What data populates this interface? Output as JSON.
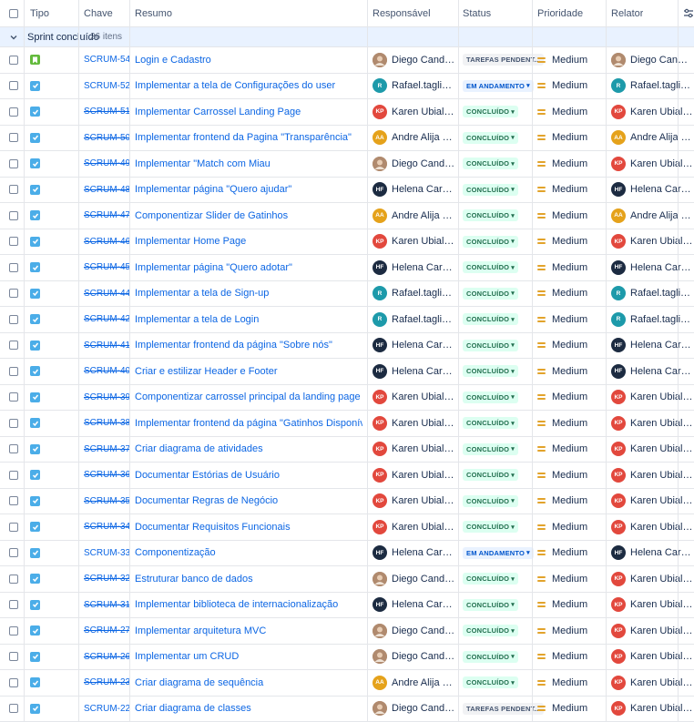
{
  "headers": {
    "type": "Tipo",
    "key": "Chave",
    "summary": "Resumo",
    "assignee": "Responsável",
    "status": "Status",
    "priority": "Prioridade",
    "reporter": "Relator"
  },
  "group": {
    "label": "Sprint concluído",
    "count": "26 itens"
  },
  "colors": {
    "story": "#63ba3c",
    "task": "#4bade8",
    "priority": "#e2a32b",
    "link": "#0c66e4"
  },
  "people": {
    "DC": {
      "initials": "",
      "color": "#c9a98a",
      "photo": true
    },
    "RT": {
      "initials": "R",
      "color": "#1d9aaa"
    },
    "KP": {
      "initials": "KP",
      "color": "#e2483d"
    },
    "AA": {
      "initials": "AA",
      "color": "#e5a21b"
    },
    "HF": {
      "initials": "HF",
      "color": "#1c2b41"
    }
  },
  "rows": [
    {
      "type": "story",
      "key": "SCRUM-54",
      "done": false,
      "summary": "Login e Cadastro",
      "assignee": "Diego Candido",
      "assignee_id": "DC",
      "status": "TAREFAS PENDENT...",
      "status_kind": "todo",
      "priority": "Medium",
      "reporter": "Diego Candido",
      "reporter_id": "DC"
    },
    {
      "type": "task",
      "key": "SCRUM-52",
      "done": false,
      "summary": "Implementar a tela de Configurações do user",
      "assignee": "Rafael.tagliaferro",
      "assignee_id": "RT",
      "status": "EM ANDAMENTO",
      "status_kind": "prog",
      "priority": "Medium",
      "reporter": "Rafael.tagliaferro",
      "reporter_id": "RT"
    },
    {
      "type": "task",
      "key": "SCRUM-51",
      "done": true,
      "summary": "Implementar Carrossel Landing Page",
      "assignee": "Karen Ubial Pereira",
      "assignee_id": "KP",
      "status": "CONCLUÍDO",
      "status_kind": "done",
      "priority": "Medium",
      "reporter": "Karen Ubial Pereira",
      "reporter_id": "KP"
    },
    {
      "type": "task",
      "key": "SCRUM-50",
      "done": true,
      "summary": "Implementar frontend da Pagina \"Transparência\"",
      "assignee": "Andre Alija Ramo...",
      "assignee_id": "AA",
      "status": "CONCLUÍDO",
      "status_kind": "done",
      "priority": "Medium",
      "reporter": "Andre Alija Ramo...",
      "reporter_id": "AA"
    },
    {
      "type": "task",
      "key": "SCRUM-49",
      "done": true,
      "summary": "Implementar \"Match com Miau",
      "assignee": "Diego Candido",
      "assignee_id": "DC",
      "status": "CONCLUÍDO",
      "status_kind": "done",
      "priority": "Medium",
      "reporter": "Karen Ubial Pereira",
      "reporter_id": "KP"
    },
    {
      "type": "task",
      "key": "SCRUM-48",
      "done": true,
      "summary": "Implementar página \"Quero ajudar\"",
      "assignee": "Helena Carvalho ...",
      "assignee_id": "HF",
      "status": "CONCLUÍDO",
      "status_kind": "done",
      "priority": "Medium",
      "reporter": "Helena Carvalho ...",
      "reporter_id": "HF"
    },
    {
      "type": "task",
      "key": "SCRUM-47",
      "done": true,
      "summary": "Componentizar Slider de Gatinhos",
      "assignee": "Andre Alija Ramo...",
      "assignee_id": "AA",
      "status": "CONCLUÍDO",
      "status_kind": "done",
      "priority": "Medium",
      "reporter": "Andre Alija Ramo...",
      "reporter_id": "AA"
    },
    {
      "type": "task",
      "key": "SCRUM-46",
      "done": true,
      "summary": "Implementar Home Page",
      "assignee": "Karen Ubial Pereira",
      "assignee_id": "KP",
      "status": "CONCLUÍDO",
      "status_kind": "done",
      "priority": "Medium",
      "reporter": "Karen Ubial Pereira",
      "reporter_id": "KP"
    },
    {
      "type": "task",
      "key": "SCRUM-45",
      "done": true,
      "summary": "Implementar página \"Quero adotar\"",
      "assignee": "Helena Carvalho ...",
      "assignee_id": "HF",
      "status": "CONCLUÍDO",
      "status_kind": "done",
      "priority": "Medium",
      "reporter": "Helena Carvalho ...",
      "reporter_id": "HF"
    },
    {
      "type": "task",
      "key": "SCRUM-44",
      "done": true,
      "summary": "Implementar a tela de Sign-up",
      "assignee": "Rafael.tagliaferro",
      "assignee_id": "RT",
      "status": "CONCLUÍDO",
      "status_kind": "done",
      "priority": "Medium",
      "reporter": "Rafael.tagliaferro",
      "reporter_id": "RT"
    },
    {
      "type": "task",
      "key": "SCRUM-42",
      "done": true,
      "summary": "Implementar a tela de Login",
      "assignee": "Rafael.tagliaferro",
      "assignee_id": "RT",
      "status": "CONCLUÍDO",
      "status_kind": "done",
      "priority": "Medium",
      "reporter": "Rafael.tagliaferro",
      "reporter_id": "RT"
    },
    {
      "type": "task",
      "key": "SCRUM-41",
      "done": true,
      "summary": "Implementar frontend da página \"Sobre nós\"",
      "assignee": "Helena Carvalho ...",
      "assignee_id": "HF",
      "status": "CONCLUÍDO",
      "status_kind": "done",
      "priority": "Medium",
      "reporter": "Helena Carvalho ...",
      "reporter_id": "HF"
    },
    {
      "type": "task",
      "key": "SCRUM-40",
      "done": true,
      "summary": "Criar e estilizar Header e Footer",
      "assignee": "Helena Carvalho ...",
      "assignee_id": "HF",
      "status": "CONCLUÍDO",
      "status_kind": "done",
      "priority": "Medium",
      "reporter": "Helena Carvalho ...",
      "reporter_id": "HF"
    },
    {
      "type": "task",
      "key": "SCRUM-39",
      "done": true,
      "summary": "Componentizar carrossel principal da landing page",
      "assignee": "Karen Ubial Pereira",
      "assignee_id": "KP",
      "status": "CONCLUÍDO",
      "status_kind": "done",
      "priority": "Medium",
      "reporter": "Karen Ubial Pereira",
      "reporter_id": "KP"
    },
    {
      "type": "task",
      "key": "SCRUM-38",
      "done": true,
      "summary": "Implementar frontend da página \"Gatinhos Disponíveis\"",
      "assignee": "Karen Ubial Pereira",
      "assignee_id": "KP",
      "status": "CONCLUÍDO",
      "status_kind": "done",
      "priority": "Medium",
      "reporter": "Karen Ubial Pereira",
      "reporter_id": "KP"
    },
    {
      "type": "task",
      "key": "SCRUM-37",
      "done": true,
      "summary": "Criar diagrama de atividades",
      "assignee": "Karen Ubial Pereira",
      "assignee_id": "KP",
      "status": "CONCLUÍDO",
      "status_kind": "done",
      "priority": "Medium",
      "reporter": "Karen Ubial Pereira",
      "reporter_id": "KP"
    },
    {
      "type": "task",
      "key": "SCRUM-36",
      "done": true,
      "summary": "Documentar Estórias de Usuário",
      "assignee": "Karen Ubial Pereira",
      "assignee_id": "KP",
      "status": "CONCLUÍDO",
      "status_kind": "done",
      "priority": "Medium",
      "reporter": "Karen Ubial Pereira",
      "reporter_id": "KP"
    },
    {
      "type": "task",
      "key": "SCRUM-35",
      "done": true,
      "summary": "Documentar Regras de Negócio",
      "assignee": "Karen Ubial Pereira",
      "assignee_id": "KP",
      "status": "CONCLUÍDO",
      "status_kind": "done",
      "priority": "Medium",
      "reporter": "Karen Ubial Pereira",
      "reporter_id": "KP"
    },
    {
      "type": "task",
      "key": "SCRUM-34",
      "done": true,
      "summary": "Documentar Requisitos Funcionais",
      "assignee": "Karen Ubial Pereira",
      "assignee_id": "KP",
      "status": "CONCLUÍDO",
      "status_kind": "done",
      "priority": "Medium",
      "reporter": "Karen Ubial Pereira",
      "reporter_id": "KP"
    },
    {
      "type": "task",
      "key": "SCRUM-33",
      "done": false,
      "summary": "Componentização",
      "assignee": "Helena Carvalho ...",
      "assignee_id": "HF",
      "status": "EM ANDAMENTO",
      "status_kind": "prog",
      "priority": "Medium",
      "reporter": "Helena Carvalho ...",
      "reporter_id": "HF"
    },
    {
      "type": "task",
      "key": "SCRUM-32",
      "done": true,
      "summary": "Estruturar banco de dados",
      "assignee": "Diego Candido",
      "assignee_id": "DC",
      "status": "CONCLUÍDO",
      "status_kind": "done",
      "priority": "Medium",
      "reporter": "Karen Ubial Pereira",
      "reporter_id": "KP"
    },
    {
      "type": "task",
      "key": "SCRUM-31",
      "done": true,
      "summary": "Implementar biblioteca de internacionalização",
      "assignee": "Helena Carvalho ...",
      "assignee_id": "HF",
      "status": "CONCLUÍDO",
      "status_kind": "done",
      "priority": "Medium",
      "reporter": "Karen Ubial Pereira",
      "reporter_id": "KP"
    },
    {
      "type": "task",
      "key": "SCRUM-27",
      "done": true,
      "summary": "Implementar arquitetura MVC",
      "assignee": "Diego Candido",
      "assignee_id": "DC",
      "status": "CONCLUÍDO",
      "status_kind": "done",
      "priority": "Medium",
      "reporter": "Karen Ubial Pereira",
      "reporter_id": "KP"
    },
    {
      "type": "task",
      "key": "SCRUM-26",
      "done": true,
      "summary": "Implementar um CRUD",
      "assignee": "Diego Candido",
      "assignee_id": "DC",
      "status": "CONCLUÍDO",
      "status_kind": "done",
      "priority": "Medium",
      "reporter": "Karen Ubial Pereira",
      "reporter_id": "KP"
    },
    {
      "type": "task",
      "key": "SCRUM-23",
      "done": true,
      "summary": "Criar diagrama de sequência",
      "assignee": "Andre Alija Ramo...",
      "assignee_id": "AA",
      "status": "CONCLUÍDO",
      "status_kind": "done",
      "priority": "Medium",
      "reporter": "Karen Ubial Pereira",
      "reporter_id": "KP"
    },
    {
      "type": "task",
      "key": "SCRUM-22",
      "done": false,
      "summary": "Criar diagrama de classes",
      "assignee": "Diego Candido",
      "assignee_id": "DC",
      "status": "TAREFAS PENDENT...",
      "status_kind": "todo",
      "priority": "Medium",
      "reporter": "Karen Ubial Pereira",
      "reporter_id": "KP"
    }
  ]
}
